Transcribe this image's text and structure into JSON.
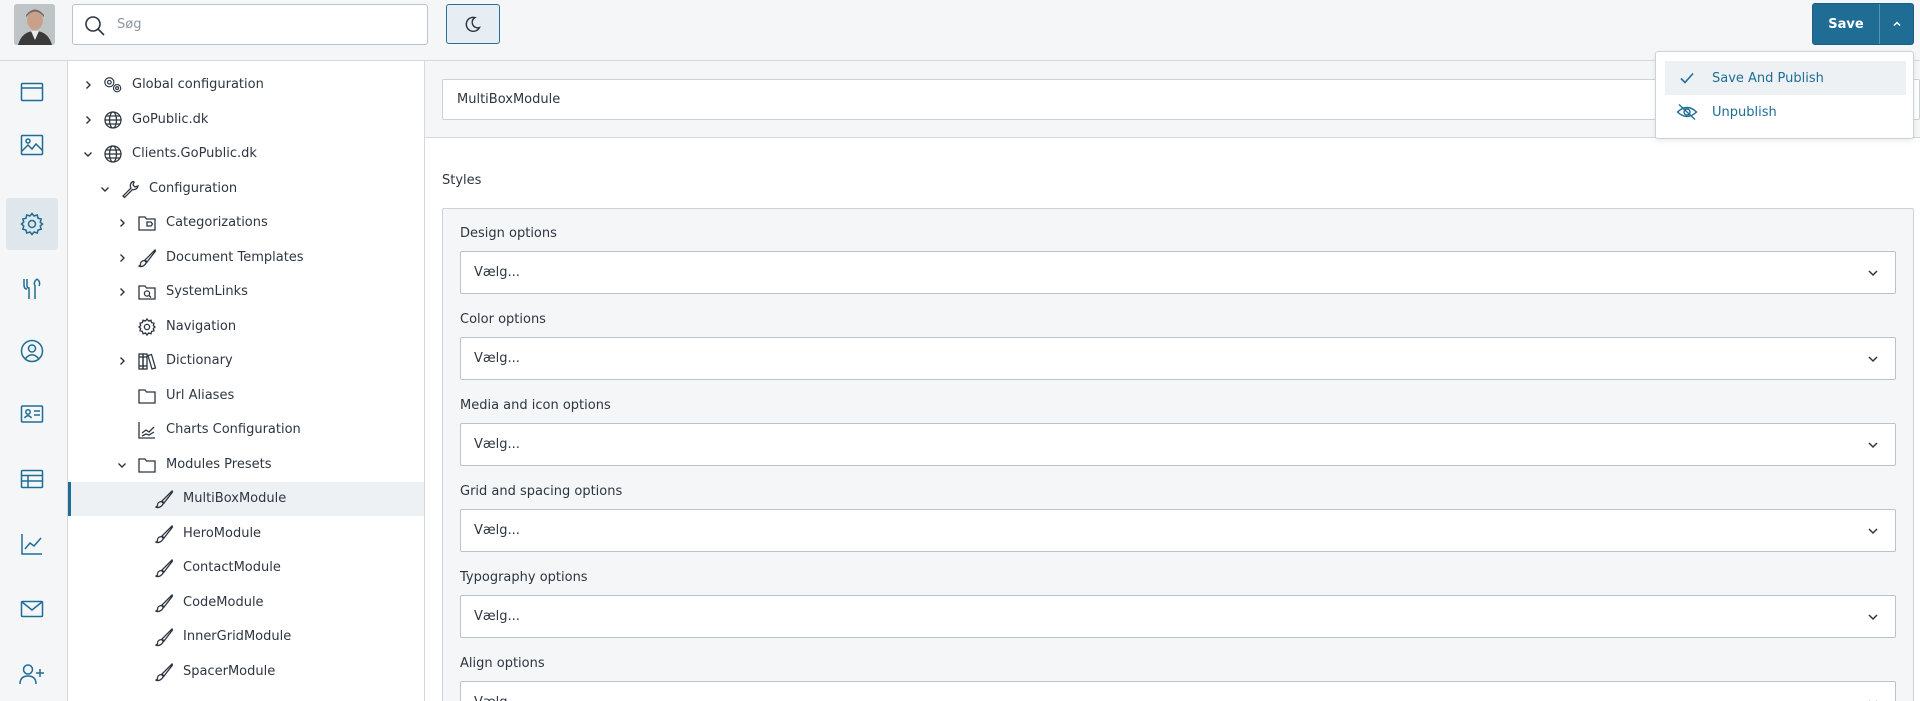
{
  "header": {
    "search_placeholder": "Søg",
    "save_label": "Save"
  },
  "save_menu": {
    "items": [
      {
        "label": "Save And Publish",
        "icon": "check-icon"
      },
      {
        "label": "Unpublish",
        "icon": "eye-off-icon"
      }
    ]
  },
  "rail": {
    "items": [
      "content-icon",
      "media-icon",
      "settings-icon",
      "tools-icon",
      "user-icon",
      "contact-card-icon",
      "table-icon",
      "analytics-icon",
      "mail-icon",
      "add-user-icon"
    ],
    "active": "settings-icon"
  },
  "tree": {
    "nodes": [
      {
        "label": "Global configuration",
        "icon": "gears-icon",
        "expand": "collapsed"
      },
      {
        "label": "GoPublic.dk",
        "icon": "globe-icon",
        "expand": "collapsed"
      },
      {
        "label": "Clients.GoPublic.dk",
        "icon": "globe-icon",
        "expand": "expanded"
      },
      {
        "label": "Configuration",
        "icon": "wrench-icon",
        "expand": "expanded"
      },
      {
        "label": "Categorizations",
        "icon": "folder-tag-icon",
        "expand": "collapsed"
      },
      {
        "label": "Document Templates",
        "icon": "brush-icon",
        "expand": "collapsed"
      },
      {
        "label": "SystemLinks",
        "icon": "folder-link-icon",
        "expand": "collapsed"
      },
      {
        "label": "Navigation",
        "icon": "gear-icon",
        "expand": "none"
      },
      {
        "label": "Dictionary",
        "icon": "books-icon",
        "expand": "collapsed"
      },
      {
        "label": "Url Aliases",
        "icon": "folder-icon",
        "expand": "none"
      },
      {
        "label": "Charts Configuration",
        "icon": "chart-icon",
        "expand": "none"
      },
      {
        "label": "Modules Presets",
        "icon": "folder-icon",
        "expand": "expanded"
      },
      {
        "label": "MultiBoxModule",
        "icon": "brush-icon",
        "expand": "none",
        "selected": true
      },
      {
        "label": "HeroModule",
        "icon": "brush-icon",
        "expand": "none"
      },
      {
        "label": "ContactModule",
        "icon": "brush-icon",
        "expand": "none"
      },
      {
        "label": "CodeModule",
        "icon": "brush-icon",
        "expand": "none"
      },
      {
        "label": "InnerGridModule",
        "icon": "brush-icon",
        "expand": "none"
      },
      {
        "label": "SpacerModule",
        "icon": "brush-icon",
        "expand": "none"
      }
    ]
  },
  "main": {
    "name_value": "MultiBoxModule",
    "section_title": "Styles",
    "options": [
      {
        "label": "Design options",
        "value": "Vælg..."
      },
      {
        "label": "Color options",
        "value": "Vælg..."
      },
      {
        "label": "Media and icon options",
        "value": "Vælg..."
      },
      {
        "label": "Grid and spacing options",
        "value": "Vælg..."
      },
      {
        "label": "Typography options",
        "value": "Vælg..."
      },
      {
        "label": "Align options",
        "value": "Vælg..."
      }
    ]
  },
  "colors": {
    "accent": "#1f6d95",
    "sidebar_bg": "#f4f6f8",
    "selected_row": "#eef1f4"
  }
}
